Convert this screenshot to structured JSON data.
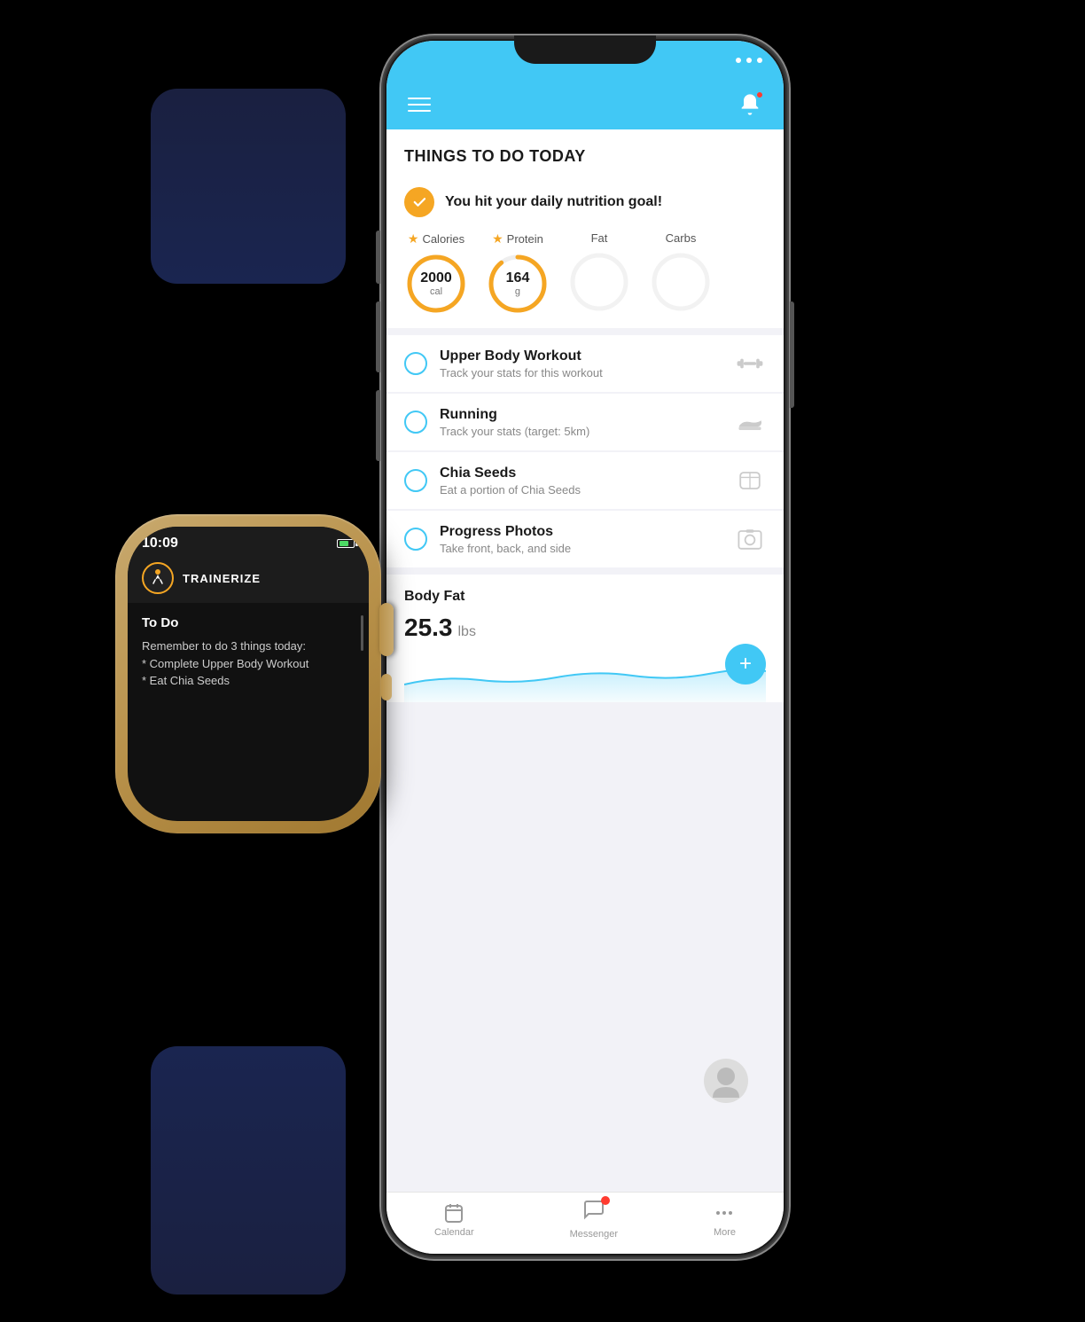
{
  "app": {
    "name": "Trainerize",
    "title": "Things To Do Today"
  },
  "phone": {
    "status_bar": {
      "time": "",
      "icons": []
    },
    "nav": {
      "menu_label": "Menu",
      "bell_label": "Notifications"
    },
    "section_title": "THINGS TO DO TODAY",
    "nutrition": {
      "goal_text": "You hit your daily nutrition goal!",
      "stats": [
        {
          "label": "Calories",
          "starred": true,
          "value": "2000",
          "unit": "cal",
          "filled": true
        },
        {
          "label": "Protein",
          "starred": true,
          "value": "164",
          "unit": "g",
          "filled": true
        },
        {
          "label": "Fat",
          "starred": false,
          "value": "",
          "unit": "",
          "filled": false
        },
        {
          "label": "Carbs",
          "starred": false,
          "value": "",
          "unit": "",
          "filled": false
        }
      ]
    },
    "todos": [
      {
        "id": "upper-body",
        "title": "Upper Body Workout",
        "subtitle": "Track your stats for this workout",
        "icon": "dumbbell",
        "checked": false
      },
      {
        "id": "running",
        "title": "Running",
        "subtitle": "Track your stats (target: 5km)",
        "icon": "shoe",
        "checked": false
      },
      {
        "id": "chia-seeds",
        "title": "Chia Seeds",
        "subtitle": "Eat a portion of Chia Seeds",
        "icon": "food",
        "checked": false
      },
      {
        "id": "progress-photos",
        "title": "Progress Photos",
        "subtitle": "Take front, back, and side",
        "icon": "photo",
        "checked": false
      }
    ],
    "body_fat": {
      "title": "Body Fat",
      "value": "25.3",
      "unit": "lbs",
      "add_label": "+"
    },
    "bottom_nav": [
      {
        "id": "calendar",
        "label": "Calendar",
        "icon": "calendar",
        "badge": false
      },
      {
        "id": "messenger",
        "label": "Messenger",
        "icon": "message",
        "badge": true
      },
      {
        "id": "more",
        "label": "More",
        "icon": "dots",
        "badge": false
      }
    ]
  },
  "watch": {
    "time": "10:09",
    "app_name": "TRAINERIZE",
    "todo": {
      "title": "To Do",
      "body": "Remember to do 3 things today:\n* Complete Upper Body Workout\n* Eat Chia Seeds"
    }
  },
  "colors": {
    "accent": "#41c8f5",
    "orange": "#f5a623",
    "red": "#ff3b30",
    "green": "#4cd964",
    "dark_navy": "#1a2040",
    "gold": "#b8914a"
  }
}
